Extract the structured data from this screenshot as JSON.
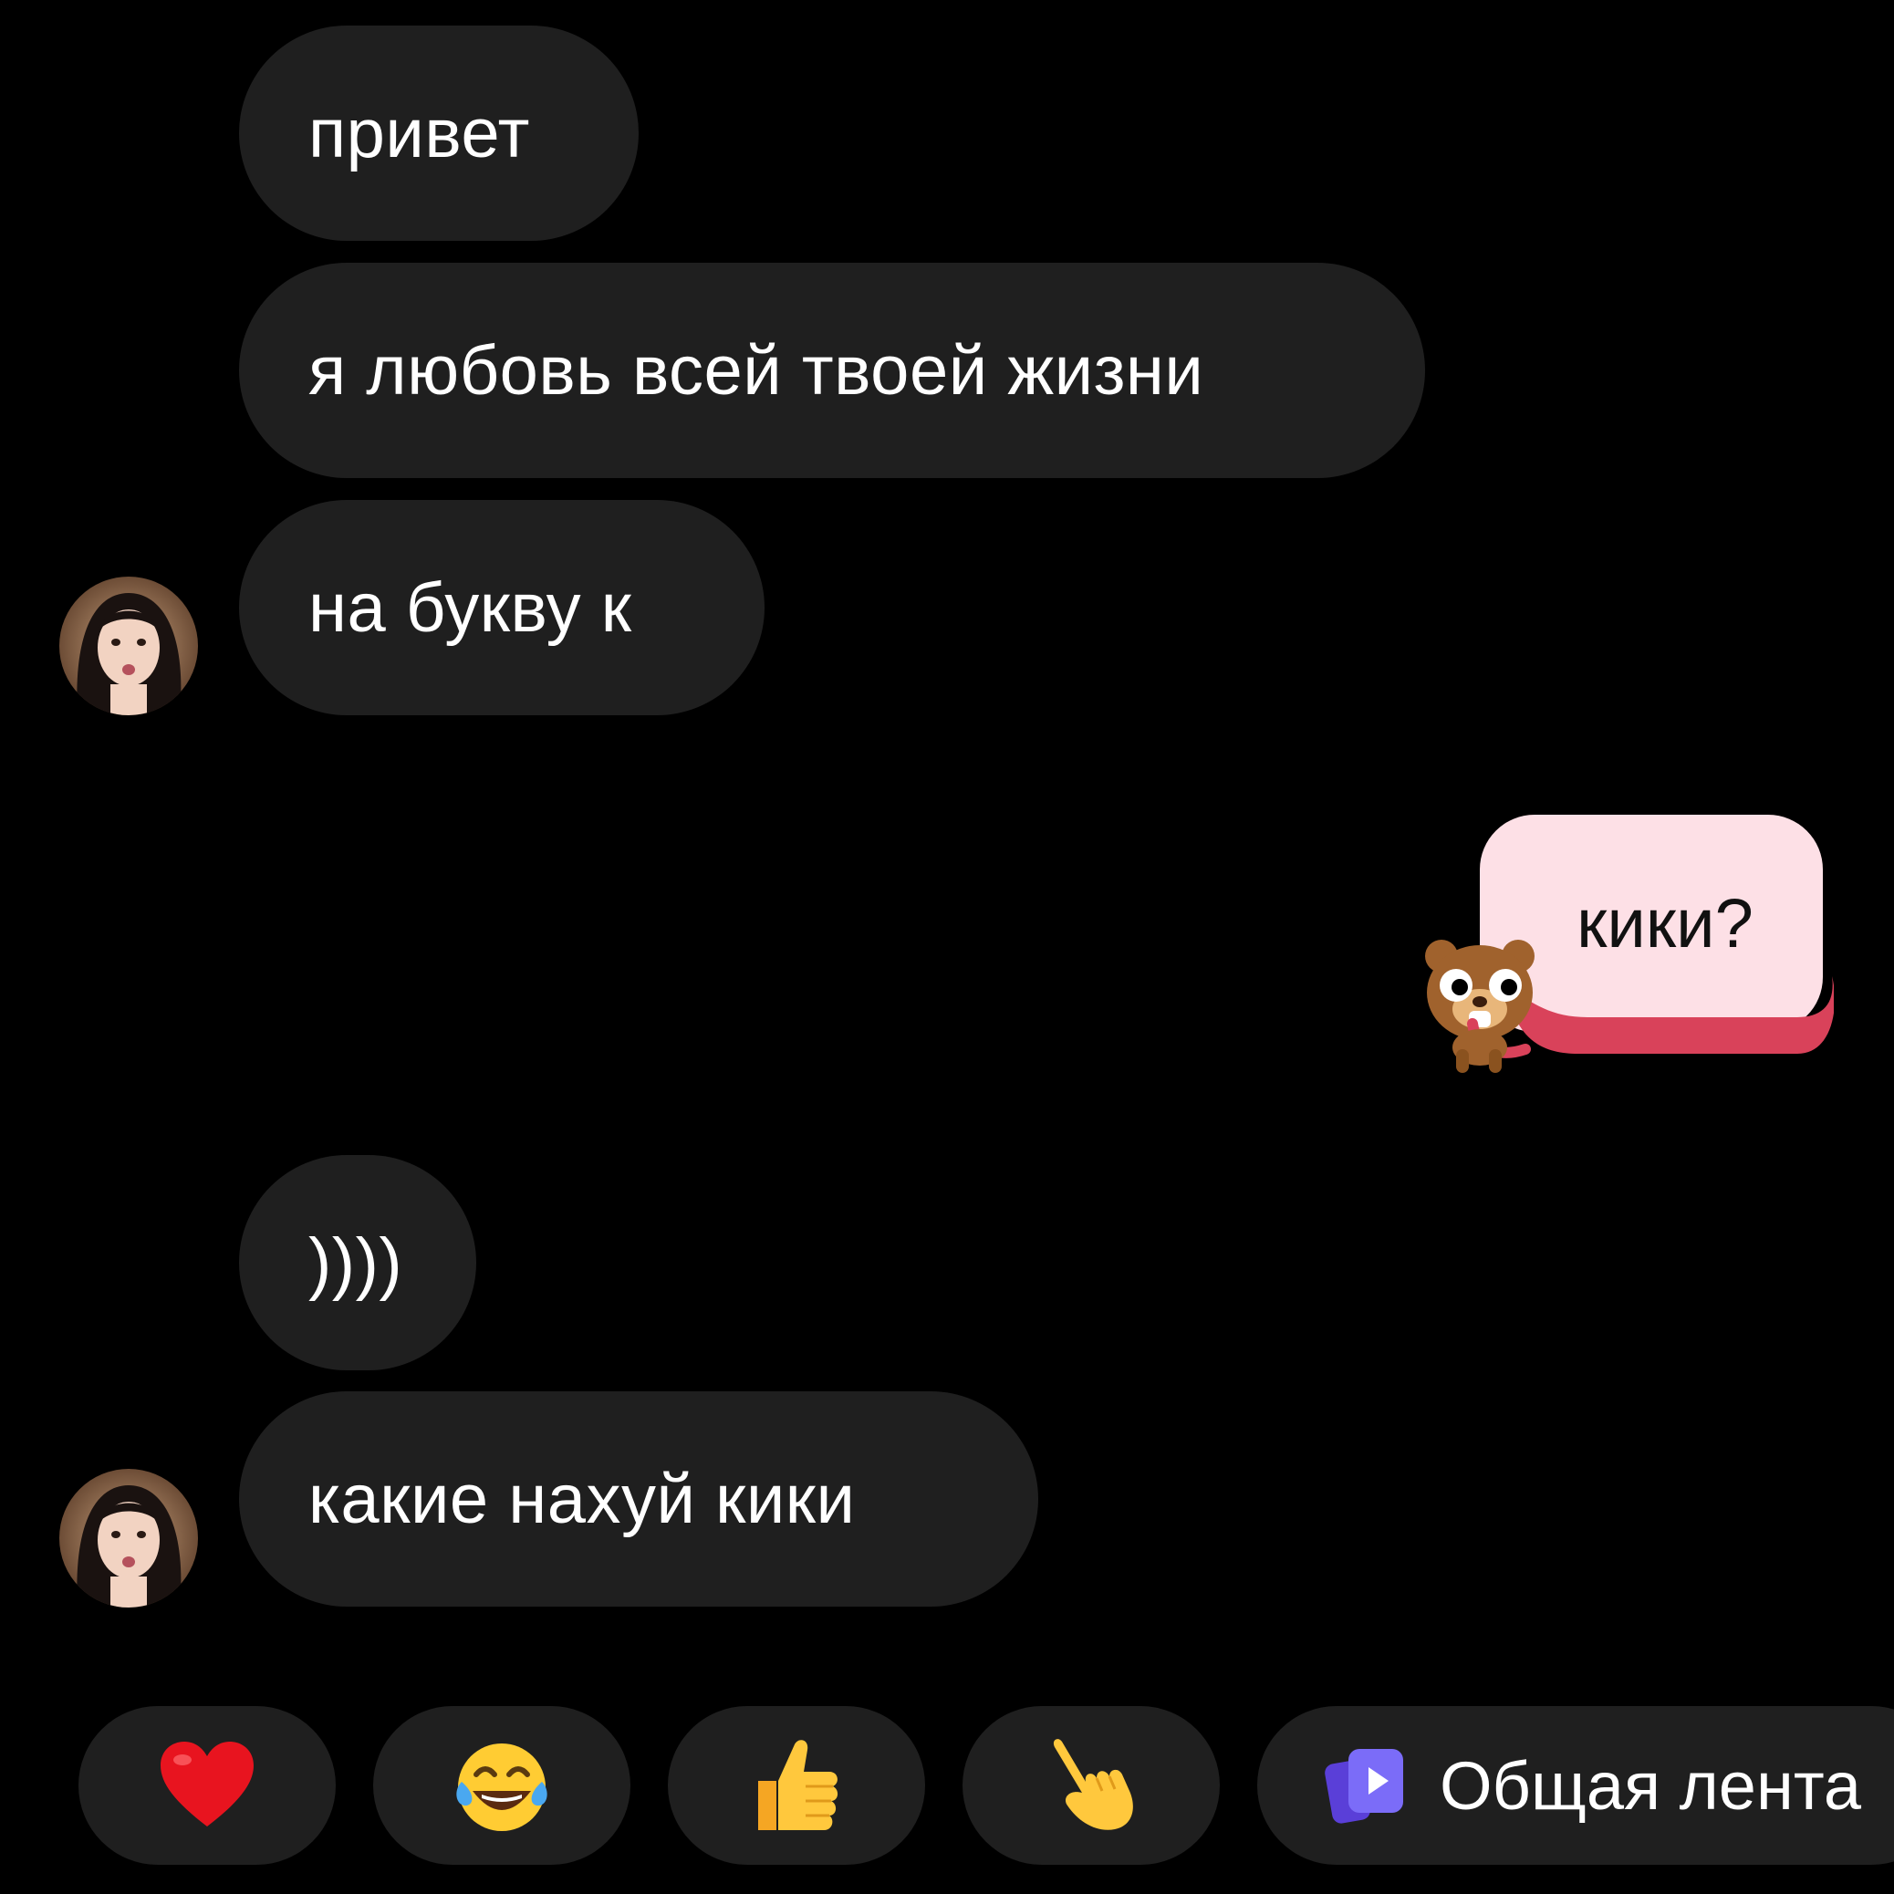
{
  "messages": [
    {
      "text": "привет"
    },
    {
      "text": "я любовь всей твоей жизни"
    },
    {
      "text": "на букву к"
    },
    {
      "text": "кики?"
    },
    {
      "text": "))))"
    },
    {
      "text": "какие нахуй кики"
    }
  ],
  "reactions": {
    "items": [
      {
        "icon": "heart-icon"
      },
      {
        "icon": "tears-of-joy-icon"
      },
      {
        "icon": "thumbs-up-icon"
      },
      {
        "icon": "pointing-down-hand-icon"
      }
    ],
    "feed_label": "Общая лента"
  },
  "colors": {
    "background": "#000000",
    "received_bubble": "#1f1f1f",
    "sent_bubble": "#fde0e6",
    "sent_accent": "#d9425a",
    "feed_icon": "#6b5cf6"
  }
}
